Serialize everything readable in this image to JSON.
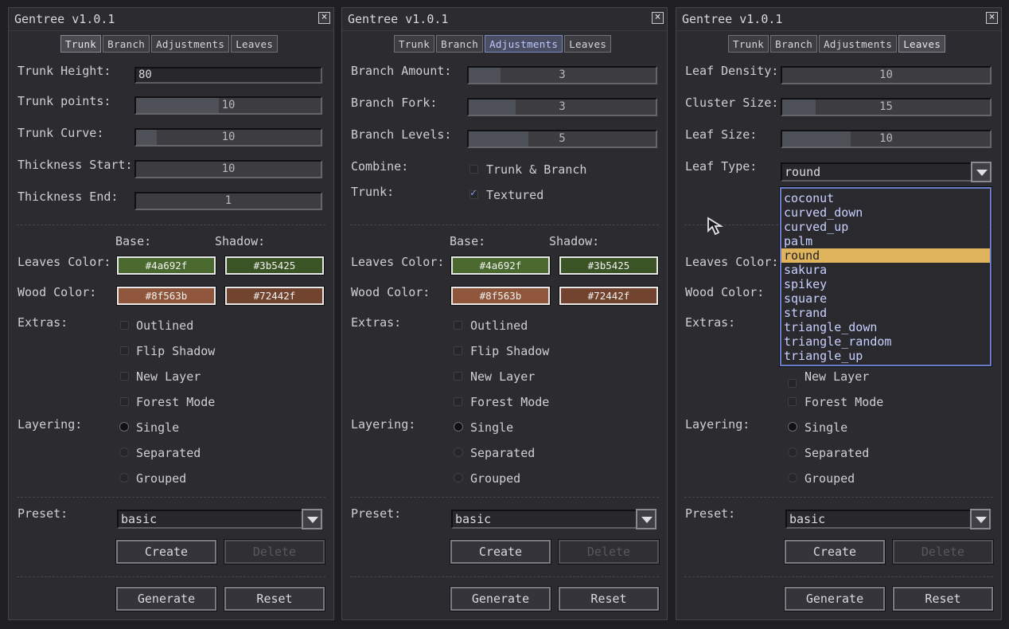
{
  "app": {
    "title": "Gentree v1.0.1",
    "close": "×"
  },
  "tabs": [
    "Trunk",
    "Branch",
    "Adjustments",
    "Leaves"
  ],
  "icons": {
    "close": "close-icon",
    "dropdown": "chevron-down-icon",
    "cursor": "cursor-arrow-icon",
    "check": "check-icon"
  },
  "colors": {
    "leaves_base": "#4a692f",
    "leaves_shadow": "#3b5425",
    "wood_base": "#8f563b",
    "wood_shadow": "#72442f",
    "accent": "#7c8cc4",
    "highlight": "#e0b45c"
  },
  "common": {
    "base_label": "Base:",
    "shadow_label": "Shadow:",
    "leaves_color_label": "Leaves Color:",
    "wood_color_label": "Wood Color:",
    "leaves_base": "#4a692f",
    "leaves_shadow": "#3b5425",
    "wood_base": "#8f563b",
    "wood_shadow": "#72442f",
    "extras_label": "Extras:",
    "extras": [
      "Outlined",
      "Flip Shadow",
      "New Layer",
      "Forest Mode"
    ],
    "layering_label": "Layering:",
    "layering": [
      "Single",
      "Separated",
      "Grouped"
    ],
    "layering_selected": "Single",
    "preset_label": "Preset:",
    "preset_value": "basic",
    "create": "Create",
    "delete": "Delete",
    "generate": "Generate",
    "reset": "Reset"
  },
  "panel1": {
    "active_tab": "Trunk",
    "trunk_height_label": "Trunk Height:",
    "trunk_height_value": "80",
    "sliders": [
      {
        "label": "Trunk points:",
        "value": "10",
        "fill": 0.45
      },
      {
        "label": "Trunk Curve:",
        "value": "10",
        "fill": 0.11
      },
      {
        "label": "Thickness Start:",
        "value": "10",
        "fill": 0
      },
      {
        "label": "Thickness End:",
        "value": "1",
        "fill": 0
      }
    ]
  },
  "panel2": {
    "active_tab": "Adjustments",
    "sliders": [
      {
        "label": "Branch Amount:",
        "value": "3",
        "fill": 0.17
      },
      {
        "label": "Branch Fork:",
        "value": "3",
        "fill": 0.25
      },
      {
        "label": "Branch Levels:",
        "value": "5",
        "fill": 0.32
      }
    ],
    "combine_label": "Combine:",
    "trunk_label": "Trunk:",
    "combine_option": "Trunk & Branch",
    "combine_checked": false,
    "trunk_option": "Textured",
    "trunk_checked": true
  },
  "panel3": {
    "active_tab": "Leaves",
    "sliders": [
      {
        "label": "Leaf Density:",
        "value": "10",
        "fill": 0
      },
      {
        "label": "Cluster Size:",
        "value": "15",
        "fill": 0.16
      },
      {
        "label": "Leaf Size:",
        "value": "10",
        "fill": 0.33
      }
    ],
    "leaf_type_label": "Leaf Type:",
    "leaf_type_value": "round",
    "leaf_types": [
      "coconut",
      "curved_down",
      "curved_up",
      "palm",
      "round",
      "sakura",
      "spikey",
      "square",
      "strand",
      "triangle_down",
      "triangle_random",
      "triangle_up"
    ]
  }
}
